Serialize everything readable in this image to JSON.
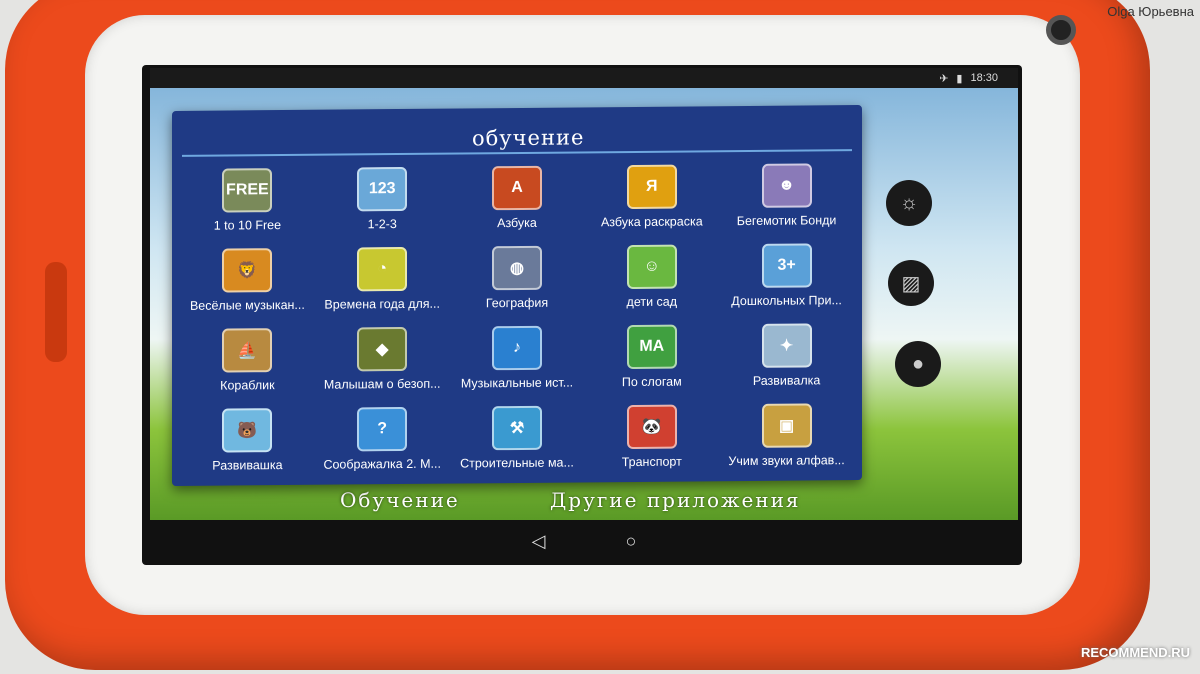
{
  "status_bar": {
    "airplane_icon": "airplane-icon",
    "battery_icon": "battery-icon",
    "time": "18:30"
  },
  "wallpaper": {
    "labels": [
      "Обучение",
      "Другие приложения"
    ]
  },
  "folder": {
    "title": "обучение",
    "apps": [
      {
        "label": "1 to 10 Free",
        "glyph": "FREE",
        "color": "#7a8a5a"
      },
      {
        "label": "1-2-3",
        "glyph": "123",
        "color": "#6aa8d8"
      },
      {
        "label": "Азбука",
        "glyph": "A",
        "color": "#c84a20"
      },
      {
        "label": "Азбука раскраска",
        "glyph": "Я",
        "color": "#e0a010"
      },
      {
        "label": "Бегемотик Бонди",
        "glyph": "☻",
        "color": "#8a7ab8"
      },
      {
        "label": "Весёлые музыкан...",
        "glyph": "🦁",
        "color": "#d88a20"
      },
      {
        "label": "Времена года для...",
        "glyph": "◔",
        "color": "#c8c830"
      },
      {
        "label": "География",
        "glyph": "◍",
        "color": "#6a7a9a"
      },
      {
        "label": "дети сад",
        "glyph": "☺",
        "color": "#6ab840"
      },
      {
        "label": "Дошкольных При...",
        "glyph": "3+",
        "color": "#5aa0d8"
      },
      {
        "label": "Кораблик",
        "glyph": "⛵",
        "color": "#b88a40"
      },
      {
        "label": "Малышам о безоп...",
        "glyph": "◆",
        "color": "#6a7a30"
      },
      {
        "label": "Музыкальные ист...",
        "glyph": "♪",
        "color": "#2a80d0"
      },
      {
        "label": "По слогам",
        "glyph": "МА",
        "color": "#40a040"
      },
      {
        "label": "Развивалка",
        "glyph": "✦",
        "color": "#9ab8d0"
      },
      {
        "label": "Развивашка",
        "glyph": "🐻",
        "color": "#70b8e0"
      },
      {
        "label": "Соображалка 2. М...",
        "glyph": "?",
        "color": "#3a90d8"
      },
      {
        "label": "Строительные ма...",
        "glyph": "⚒",
        "color": "#3a9ad0"
      },
      {
        "label": "Транспорт",
        "glyph": "🐼",
        "color": "#d04030"
      },
      {
        "label": "Учим звуки алфав...",
        "glyph": "▣",
        "color": "#c8a040"
      }
    ]
  },
  "side_buttons": [
    {
      "icon": "brightness-icon",
      "glyph": "☼"
    },
    {
      "icon": "gallery-icon",
      "glyph": "▨"
    },
    {
      "icon": "circle-icon",
      "glyph": "●"
    }
  ],
  "nav": {
    "back": "◁",
    "home": "○"
  },
  "watermarks": {
    "author": "Olga Юрьевна",
    "site": "RECOMMEND.RU"
  }
}
